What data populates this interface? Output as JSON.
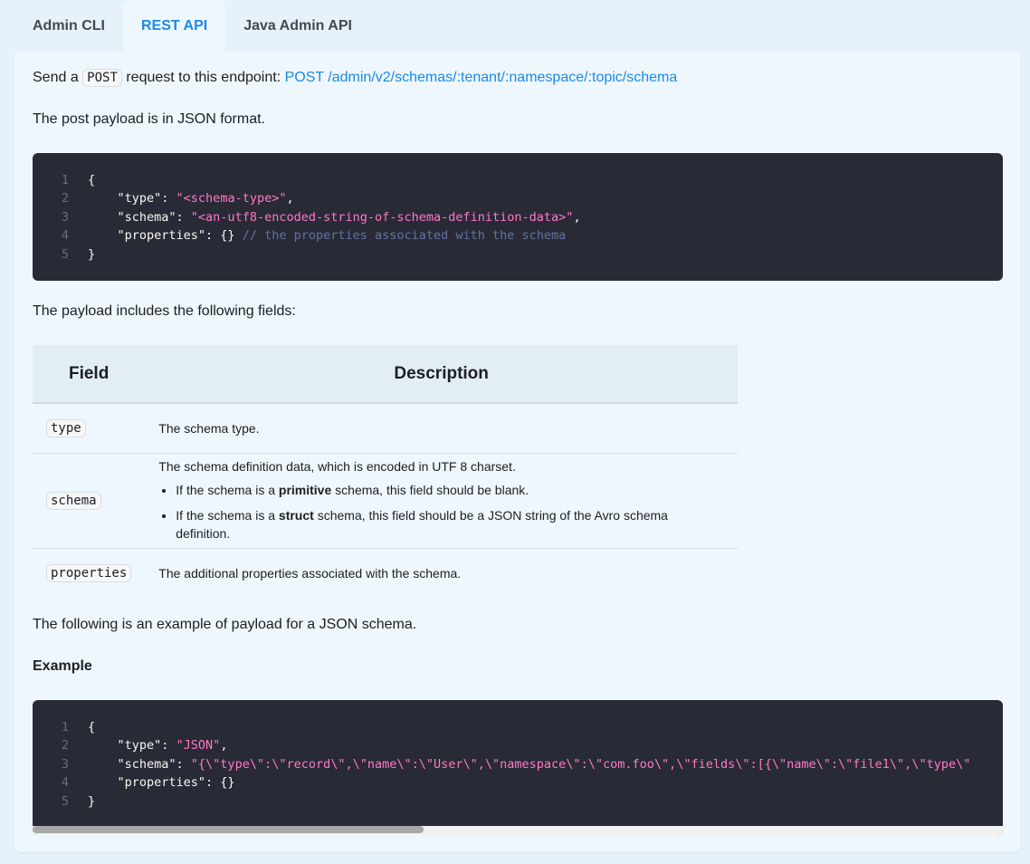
{
  "tabs": [
    {
      "label": "Admin CLI",
      "active": false
    },
    {
      "label": "REST API",
      "active": true
    },
    {
      "label": "Java Admin API",
      "active": false
    }
  ],
  "intro": {
    "prefix": "Send a",
    "method_code": "POST",
    "middle": "request to this endpoint:",
    "endpoint_link": "POST /admin/v2/schemas/:tenant/:namespace/:topic/schema"
  },
  "payload_format_text": "The post payload is in JSON format.",
  "code1": {
    "lines": [
      {
        "n": "1",
        "segments": [
          {
            "t": "{",
            "c": ""
          }
        ]
      },
      {
        "n": "2",
        "segments": [
          {
            "t": "    \"type\": ",
            "c": ""
          },
          {
            "t": "\"<schema-type>\"",
            "c": "str"
          },
          {
            "t": ",",
            "c": ""
          }
        ]
      },
      {
        "n": "3",
        "segments": [
          {
            "t": "    \"schema\": ",
            "c": ""
          },
          {
            "t": "\"<an-utf8-encoded-string-of-schema-definition-data>\"",
            "c": "str"
          },
          {
            "t": ",",
            "c": ""
          }
        ]
      },
      {
        "n": "4",
        "segments": [
          {
            "t": "    \"properties\": {} ",
            "c": ""
          },
          {
            "t": "// the properties associated with the schema",
            "c": "cmt"
          }
        ]
      },
      {
        "n": "5",
        "segments": [
          {
            "t": "}",
            "c": ""
          }
        ]
      }
    ]
  },
  "fields_intro": "The payload includes the following fields:",
  "table": {
    "headers": {
      "field": "Field",
      "description": "Description"
    },
    "rows": {
      "type": {
        "field": "type",
        "desc": "The schema type."
      },
      "schema": {
        "field": "schema",
        "desc": "The schema definition data, which is encoded in UTF 8 charset.",
        "bullet1": {
          "pre": "If the schema is a",
          "bold": "primitive",
          "post": "schema, this field should be blank."
        },
        "bullet2": {
          "pre": "If the schema is a",
          "bold": "struct",
          "post": "schema, this field should be a JSON string of the Avro schema definition."
        }
      },
      "properties": {
        "field": "properties",
        "desc": "The additional properties associated with the schema."
      }
    }
  },
  "example_intro": "The following is an example of payload for a JSON schema.",
  "example_heading": "Example",
  "code2": {
    "lines": [
      {
        "n": "1",
        "segments": [
          {
            "t": "{",
            "c": ""
          }
        ]
      },
      {
        "n": "2",
        "segments": [
          {
            "t": "    \"type\": ",
            "c": ""
          },
          {
            "t": "\"JSON\"",
            "c": "str"
          },
          {
            "t": ",",
            "c": ""
          }
        ]
      },
      {
        "n": "3",
        "segments": [
          {
            "t": "    \"schema\": ",
            "c": ""
          },
          {
            "t": "\"{\\\"type\\\":\\\"record\\\",\\\"name\\\":\\\"User\\\",\\\"namespace\\\":\\\"com.foo\\\",\\\"fields\\\":[{\\\"name\\\":\\\"file1\\\",\\\"type\\\"",
            "c": "str"
          }
        ]
      },
      {
        "n": "4",
        "segments": [
          {
            "t": "    \"properties\": {}",
            "c": ""
          }
        ]
      },
      {
        "n": "5",
        "segments": [
          {
            "t": "}",
            "c": ""
          }
        ]
      }
    ]
  }
}
